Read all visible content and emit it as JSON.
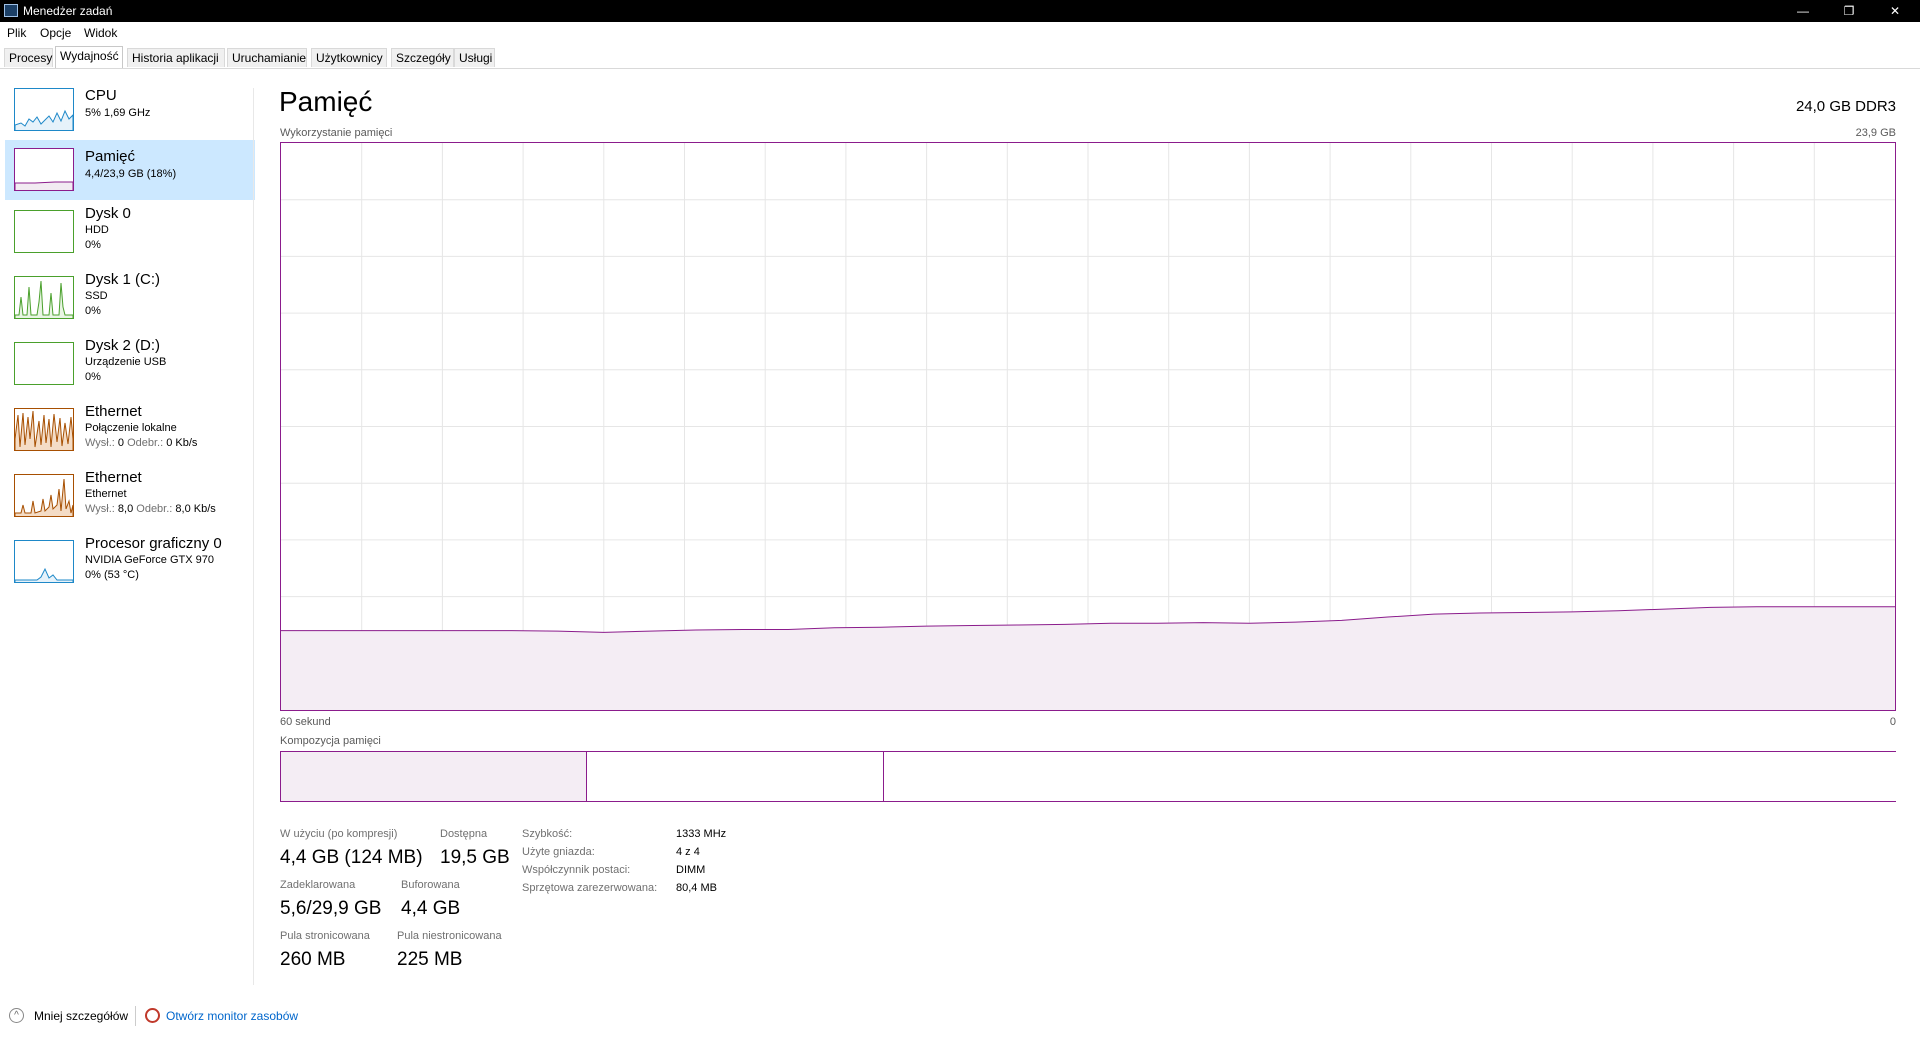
{
  "window": {
    "title": "Menedżer zadań",
    "buttons": {
      "minimize": "—",
      "maximize": "❐",
      "close": "✕"
    }
  },
  "menu": [
    "Plik",
    "Opcje",
    "Widok"
  ],
  "tabs": [
    "Procesy",
    "Wydajność",
    "Historia aplikacji",
    "Uruchamianie",
    "Użytkownicy",
    "Szczegóły",
    "Usługi"
  ],
  "active_tab": "Wydajność",
  "sidebar": [
    {
      "title": "CPU",
      "lines": [
        "5%  1,69 GHz"
      ],
      "color": "#1e88c8",
      "icon": "cpu-graph"
    },
    {
      "title": "Pamięć",
      "lines": [
        "4,4/23,9 GB (18%)"
      ],
      "color": "#8b1c8c",
      "selected": true,
      "icon": "memory-graph"
    },
    {
      "title": "Dysk 0",
      "lines": [
        "HDD",
        "0%"
      ],
      "color": "#4aa02c",
      "icon": "disk-graph"
    },
    {
      "title": "Dysk 1 (C:)",
      "lines": [
        "SSD",
        "0%"
      ],
      "color": "#4aa02c",
      "icon": "disk-graph"
    },
    {
      "title": "Dysk 2 (D:)",
      "lines": [
        "Urządzenie USB",
        "0%"
      ],
      "color": "#4aa02c",
      "icon": "disk-graph"
    },
    {
      "title": "Ethernet",
      "lines": [
        "Połączenie lokalne"
      ],
      "net": {
        "send_label": "Wysł.:",
        "send_value": "0",
        "recv_label": "Odebr.:",
        "recv_value": "0 Kb/s"
      },
      "color": "#a74f01",
      "icon": "network-graph"
    },
    {
      "title": "Ethernet",
      "lines": [
        "Ethernet"
      ],
      "net": {
        "send_label": "Wysł.:",
        "send_value": "8,0",
        "recv_label": "Odebr.:",
        "recv_value": "8,0 Kb/s"
      },
      "color": "#a74f01",
      "icon": "network-graph"
    },
    {
      "title": "Procesor graficzny 0",
      "lines": [
        "NVIDIA GeForce GTX 970",
        "0% (53 °C)"
      ],
      "color": "#1e88c8",
      "icon": "gpu-graph"
    }
  ],
  "main": {
    "title": "Pamięć",
    "spec": "24,0 GB DDR3",
    "usage_label": "Wykorzystanie pamięci",
    "usage_max": "23,9 GB",
    "axis_left": "60 sekund",
    "axis_right": "0",
    "composition_label": "Kompozycja pamięci",
    "accent_color": "#8b1c8c",
    "usage_series_percent": [
      14.0,
      14.0,
      14.0,
      14.0,
      14.0,
      14.0,
      13.9,
      13.7,
      13.9,
      14.1,
      14.2,
      14.2,
      14.5,
      14.6,
      14.8,
      14.9,
      15.0,
      15.1,
      15.3,
      15.3,
      15.4,
      15.3,
      15.5,
      15.8,
      16.4,
      16.9,
      17.1,
      17.2,
      17.3,
      17.5,
      17.8,
      18.1,
      18.2,
      18.2,
      18.2,
      18.2
    ],
    "composition_percent": {
      "in_use": 18.4,
      "modified": 0.5,
      "standby": 18.4,
      "free": 63
    },
    "stats": {
      "in_use_label": "W użyciu (po kompresji)",
      "in_use_value": "4,4 GB (124 MB)",
      "available_label": "Dostępna",
      "available_value": "19,5 GB",
      "committed_label": "Zadeklarowana",
      "committed_value": "5,6/29,9 GB",
      "cached_label": "Buforowana",
      "cached_value": "4,4 GB",
      "paged_label": "Pula stronicowana",
      "paged_value": "260 MB",
      "nonpaged_label": "Pula niestronicowana",
      "nonpaged_value": "225 MB"
    },
    "specs": [
      {
        "label": "Szybkość:",
        "value": "1333 MHz"
      },
      {
        "label": "Użyte gniazda:",
        "value": "4 z 4"
      },
      {
        "label": "Współczynnik postaci:",
        "value": "DIMM"
      },
      {
        "label": "Sprzętowa zarezerwowana:",
        "value": "80,4 MB"
      }
    ]
  },
  "bottom": {
    "fewer_details": "Mniej szczegółów",
    "open_monitor": "Otwórz monitor zasobów"
  }
}
